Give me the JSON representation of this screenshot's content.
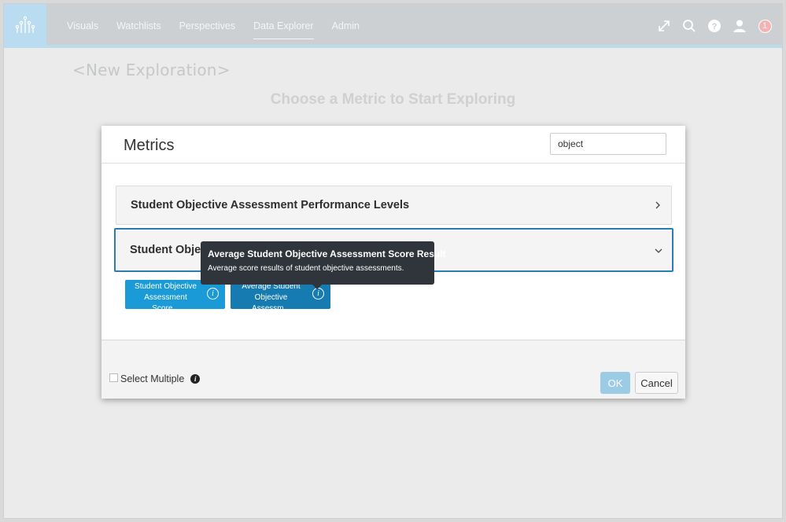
{
  "nav": {
    "items": [
      {
        "label": "Visuals",
        "active": false
      },
      {
        "label": "Watchlists",
        "active": false
      },
      {
        "label": "Perspectives",
        "active": false
      },
      {
        "label": "Data Explorer",
        "active": true
      },
      {
        "label": "Admin",
        "active": false
      }
    ],
    "icons": [
      "expand-icon",
      "search-icon",
      "help-icon",
      "user-icon"
    ],
    "notification_count": "1"
  },
  "page": {
    "title": "<New Exploration>",
    "subtitle": "Choose a Metric to Start Exploring"
  },
  "modal": {
    "title": "Metrics",
    "search_value": "object",
    "groups": [
      {
        "label": "Student Objective Assessment Performance Levels",
        "expanded": false
      },
      {
        "label": "Student Obje",
        "expanded": true
      }
    ],
    "metrics": [
      {
        "label": "Student Objective Assessment Score..."
      },
      {
        "label": "Average Student Objective Assessm..."
      }
    ],
    "tooltip": {
      "title": "Average Student Objective Assessment Score Result",
      "description": "Average score results of student objective assessments."
    },
    "footer": {
      "select_multiple_label": "Select Multiple",
      "ok_label": "OK",
      "cancel_label": "Cancel"
    }
  }
}
